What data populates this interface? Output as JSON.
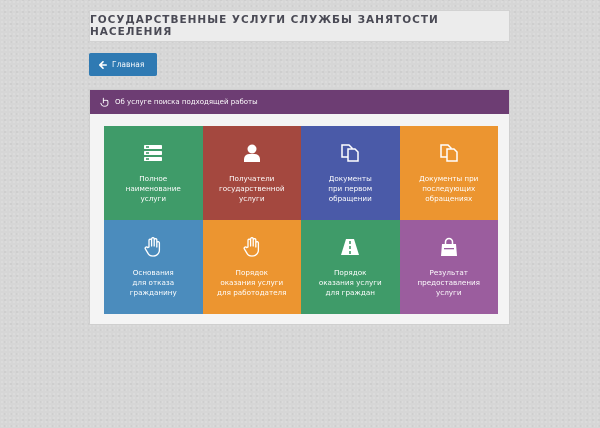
{
  "header": {
    "title": "ГОСУДАРСТВЕННЫЕ УСЛУГИ СЛУЖБЫ ЗАНЯТОСТИ НАСЕЛЕНИЯ"
  },
  "nav": {
    "home_label": "Главная"
  },
  "panel": {
    "title": "Об услуге поиска подходящей работы"
  },
  "tiles": [
    {
      "label": "Полное\nнаименование\nуслуги",
      "color": "#3f9b69",
      "icon": "list-icon"
    },
    {
      "label": "Получатели\nгосударственной\nуслуги",
      "color": "#a4483f",
      "icon": "user-icon"
    },
    {
      "label": "Документы\nпри первом\nобращении",
      "color": "#4a5aa8",
      "icon": "documents-icon"
    },
    {
      "label": "Документы при\nпоследующих\nобращениях",
      "color": "#ec9530",
      "icon": "documents-icon"
    },
    {
      "label": "Основания\nдля отказа\nгражданину",
      "color": "#4b8cbd",
      "icon": "hand-icon"
    },
    {
      "label": "Порядок\nоказания услуги\nдля работодателя",
      "color": "#ec9530",
      "icon": "hand-icon"
    },
    {
      "label": "Порядок\nоказания услуги\nдля граждан",
      "color": "#3f9b69",
      "icon": "road-icon"
    },
    {
      "label": "Результат\nпредоставления\nуслуги",
      "color": "#9b5d9e",
      "icon": "bag-icon"
    }
  ]
}
